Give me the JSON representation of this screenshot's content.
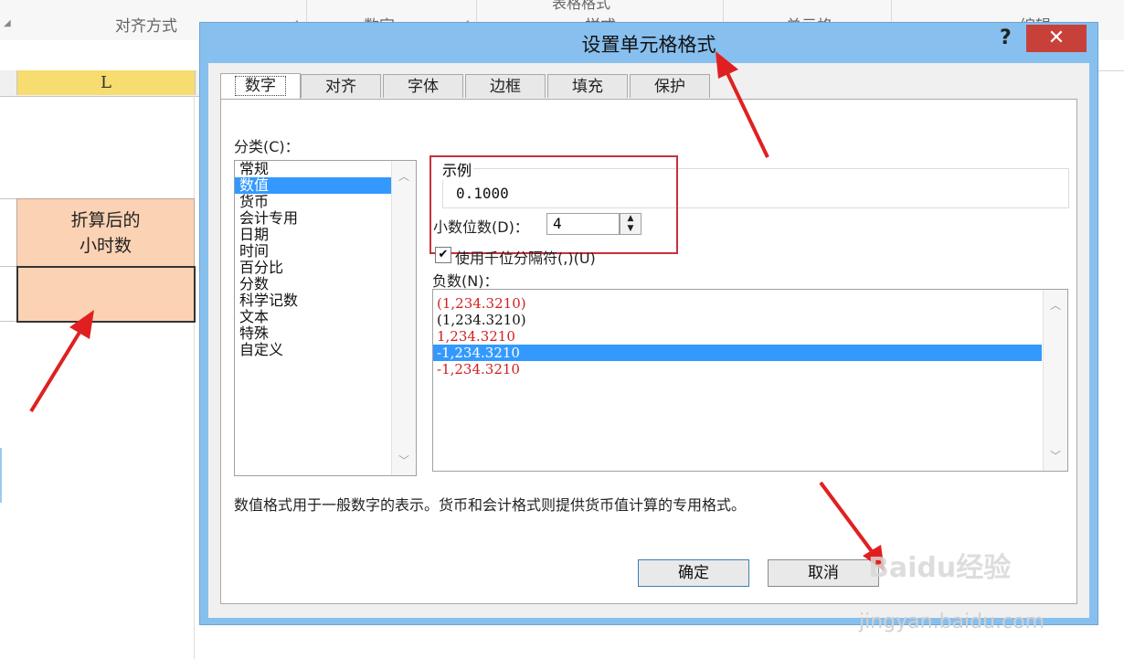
{
  "ribbon": {
    "groups": [
      "对齐方式",
      "数字",
      "样式",
      "单元格",
      "编辑"
    ],
    "top_label": "表格格式"
  },
  "sheet": {
    "column_label": "L",
    "header_cell_line1": "折算后的",
    "header_cell_line2": "小时数"
  },
  "dialog": {
    "title": "设置单元格格式",
    "help": "?",
    "close": "✕",
    "tabs": [
      "数字",
      "对齐",
      "字体",
      "边框",
      "填充",
      "保护"
    ],
    "active_tab": "数字",
    "category_label": "分类(C)：",
    "categories": [
      "常规",
      "数值",
      "货币",
      "会计专用",
      "日期",
      "时间",
      "百分比",
      "分数",
      "科学记数",
      "文本",
      "特殊",
      "自定义"
    ],
    "selected_category": "数值",
    "sample_label": "示例",
    "sample_value": "0.1000",
    "decimal_label": "小数位数(D)：",
    "decimal_value": "4",
    "thousands_label": "使用千位分隔符(,)(U)",
    "negative_label": "负数(N)：",
    "negative_options": [
      "(1,234.3210)",
      "(1,234.3210)",
      "1,234.3210",
      "-1,234.3210",
      "-1,234.3210"
    ],
    "negative_selected_index": 3,
    "description": "数值格式用于一般数字的表示。货币和会计格式则提供货币值计算的专用格式。",
    "ok_label": "确定",
    "cancel_label": "取消"
  },
  "watermark": {
    "text": "Baidu经验",
    "url": "jingyan.baidu.com"
  },
  "colors": {
    "dialog_frame": "#87bfee",
    "close_button": "#c7413a",
    "selection": "#3399ff",
    "cell_fill": "#fbd2b3",
    "column_header_selected": "#f7dc6f",
    "annotation_red": "#c8313a",
    "negative_red": "#d11f1f"
  }
}
